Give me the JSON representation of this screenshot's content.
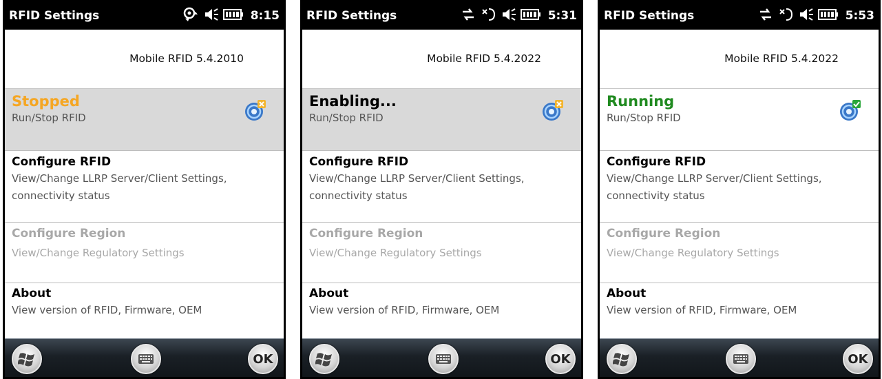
{
  "colors": {
    "stopped": "#f5a623",
    "enabling": "#000000",
    "running": "#208a20"
  },
  "screens": [
    {
      "app_title": "RFID Settings",
      "time": "8:15",
      "version_prefix": "",
      "version": "Mobile RFID 5.4.2010",
      "runstop": {
        "status": "Stopped",
        "status_color": "#f5a623",
        "desc": "Run/Stop RFID",
        "icon": "rfid-stopped-icon"
      },
      "configure_rfid": {
        "title": "Configure RFID",
        "desc1": "View/Change LLRP Server/Client Settings,",
        "desc2": "connectivity status"
      },
      "configure_region": {
        "title": "Configure Region",
        "desc": "View/Change Regulatory Settings"
      },
      "about": {
        "title": "About",
        "desc": "View version of RFID, Firmware, OEM"
      },
      "softkeys": {
        "ok": "OK"
      }
    },
    {
      "app_title": "RFID Settings",
      "time": "5:31",
      "version_prefix": "",
      "version": "Mobile RFID 5.4.2022",
      "runstop": {
        "status": "Enabling...",
        "status_color": "#000000",
        "desc": "Run/Stop RFID",
        "icon": "rfid-stopped-icon"
      },
      "configure_rfid": {
        "title": "Configure RFID",
        "desc1": "View/Change LLRP Server/Client Settings,",
        "desc2": "connectivity status"
      },
      "configure_region": {
        "title": "Configure Region",
        "desc": "View/Change Regulatory Settings"
      },
      "about": {
        "title": "About",
        "desc": "View version of RFID, Firmware, OEM"
      },
      "softkeys": {
        "ok": "OK"
      }
    },
    {
      "app_title": "RFID Settings",
      "time": "5:53",
      "version_prefix": "",
      "version": "Mobile RFID 5.4.2022",
      "runstop": {
        "status": "Running",
        "status_color": "#208a20",
        "desc": "Run/Stop RFID",
        "icon": "rfid-running-icon"
      },
      "configure_rfid": {
        "title": "Configure RFID",
        "desc1": "View/Change LLRP Server/Client Settings,",
        "desc2": "connectivity status"
      },
      "configure_region": {
        "title": "Configure Region",
        "desc": "View/Change Regulatory Settings"
      },
      "about": {
        "title": "About",
        "desc": "View version of RFID, Firmware, OEM"
      },
      "softkeys": {
        "ok": "OK"
      }
    }
  ]
}
